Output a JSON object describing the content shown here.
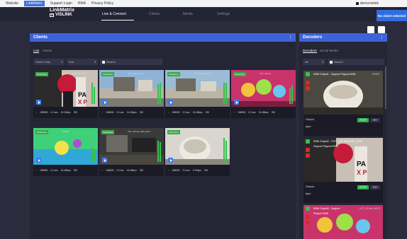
{
  "system_bar": {
    "items": [
      "Website",
      "LinkMatrix",
      "Support Login",
      "RMA",
      "Privacy Policy"
    ],
    "user": "demovislink"
  },
  "header": {
    "brand_line1": "LinkMatrix",
    "brand_line2": "VISLINK",
    "brand_icon": "VI",
    "tabs": [
      "Live & Connect",
      "Clients",
      "Media",
      "Settings"
    ],
    "active_tab": "Live & Connect"
  },
  "toast": "No client selected",
  "clients": {
    "title": "Clients",
    "tabs": [
      "Live",
      "Assets"
    ],
    "filter": "Online Only",
    "sort": "Sort",
    "search_placeholder": "Search",
    "cards": [
      {
        "badge": "Streaming",
        "title": "VXT1-HD_BACKUP_TEST",
        "res": "1080i50",
        "latency": "0.2 sec",
        "bitrate": "10.1Mbps",
        "codec": "SDI"
      },
      {
        "badge": "Streaming",
        "title": "VXT_4Ports_ES",
        "res": "1080i50",
        "latency": "0.0 sec",
        "bitrate": "16.1Mbps",
        "codec": "SDI"
      },
      {
        "badge": "Streaming",
        "title": "VXT_4Ports_MCE",
        "res": "1080i50",
        "latency": "0.0 sec",
        "bitrate": "15.4Mbps",
        "codec": "SDI"
      },
      {
        "badge": "Streaming",
        "title": "VXT_4Ports",
        "res": "1080i50",
        "latency": "0.0 sec",
        "bitrate": "15.4Mbps",
        "codec": "SDI"
      },
      {
        "badge": "Streaming",
        "title": "VXT8-8",
        "res": "1080i50",
        "latency": "0.0 sec",
        "bitrate": "16.4Mbps",
        "codec": "SDI"
      },
      {
        "badge": "Streaming",
        "title": "VXT_4Ports_MCE_EXT",
        "res": "1080i50",
        "latency": "0.0 sec",
        "bitrate": "15.3Mbps",
        "codec": "SDI"
      },
      {
        "badge": "Streaming",
        "title": "",
        "res": "1080i50",
        "latency": "2.0 sec",
        "bitrate": "3.7Mbps",
        "codec": "SDI"
      }
    ]
  },
  "decoders": {
    "title": "Decoders",
    "tabs": [
      "Decoders",
      "Social Media"
    ],
    "filter": "All",
    "search_placeholder": "Search",
    "items": [
      {
        "title": "5056 Output1 - Support Playout 5056",
        "status": "START",
        "output_label": "Output",
        "type_label": "type",
        "rtsp": "RTSP",
        "srt": "SRT"
      },
      {
        "title": "5056 Output2 - VXT1_HD_BACKUP_TEST",
        "sub": "Support Playout 5056",
        "output_label": "Output",
        "type_label": "type",
        "rtsp": "RTSP",
        "srt": "SRT"
      },
      {
        "title": "5056 Output3 - Support",
        "sub": "Playout 5056",
        "extra": "VXT_4Ports_MCE"
      }
    ]
  }
}
